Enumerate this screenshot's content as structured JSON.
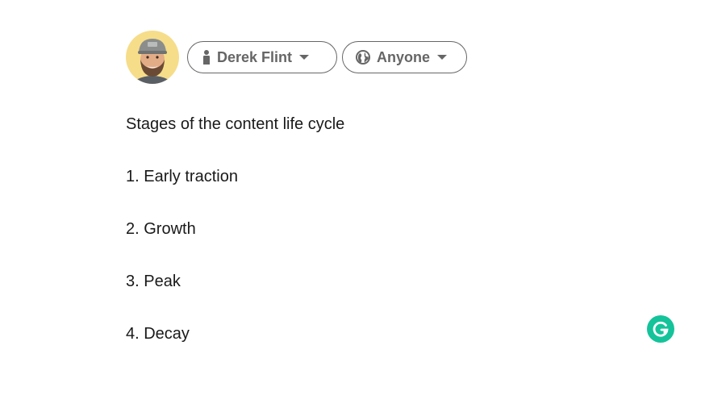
{
  "composer": {
    "author_label": "Derek Flint",
    "audience_label": "Anyone",
    "icons": {
      "avatar": "user-avatar",
      "author": "person-icon",
      "audience": "globe-icon",
      "caret": "caret-down-icon",
      "grammarly": "grammarly-g-icon"
    }
  },
  "post": {
    "lines": [
      "Stages of the content life cycle",
      "1. Early traction",
      "2. Growth",
      "3. Peak",
      "4. Decay"
    ]
  },
  "colors": {
    "pill_text": "#666666",
    "grammarly": "#15c39a",
    "avatar_bg": "#f6dd8a"
  }
}
